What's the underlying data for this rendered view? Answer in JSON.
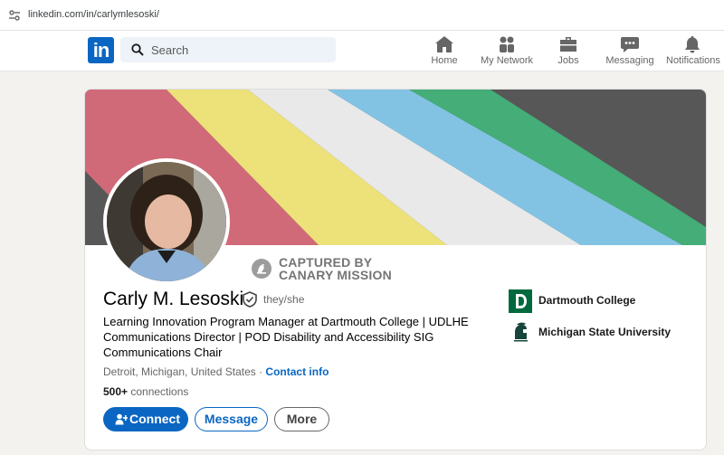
{
  "browser": {
    "url": "linkedin.com/in/carlymlesoski/"
  },
  "nav": {
    "logo_text": "in",
    "search_placeholder": "Search",
    "items": [
      {
        "label": "Home",
        "icon": "home-icon"
      },
      {
        "label": "My Network",
        "icon": "network-icon"
      },
      {
        "label": "Jobs",
        "icon": "briefcase-icon"
      },
      {
        "label": "Messaging",
        "icon": "messaging-icon"
      },
      {
        "label": "Notifications",
        "icon": "bell-icon"
      }
    ]
  },
  "banner": {
    "stripe_colors": [
      "#d06a78",
      "#ede17a",
      "#e9e9e9",
      "#82c3e3",
      "#45ad77"
    ],
    "background": "#575757"
  },
  "watermark": {
    "line1": "CAPTURED BY",
    "line2": "CANARY MISSION"
  },
  "profile": {
    "name": "Carly M. Lesoski",
    "pronouns": "they/she",
    "headline": "Learning Innovation Program Manager at Dartmouth College | UDLHE Communications Director | POD Disability and Accessibility SIG Communications Chair",
    "location": "Detroit, Michigan, United States",
    "location_sep": " · ",
    "contact_info": "Contact info",
    "connections_count": "500+",
    "connections_label": " connections"
  },
  "actions": {
    "connect": "Connect",
    "message": "Message",
    "more": "More"
  },
  "education": [
    {
      "name": "Dartmouth College",
      "logo": "dartmouth-logo",
      "color": "#00693e"
    },
    {
      "name": "Michigan State University",
      "logo": "spartan-helmet-logo",
      "color": "#18453b"
    }
  ],
  "colors": {
    "accent": "#0a66c2",
    "page_bg": "#f4f2ee"
  }
}
